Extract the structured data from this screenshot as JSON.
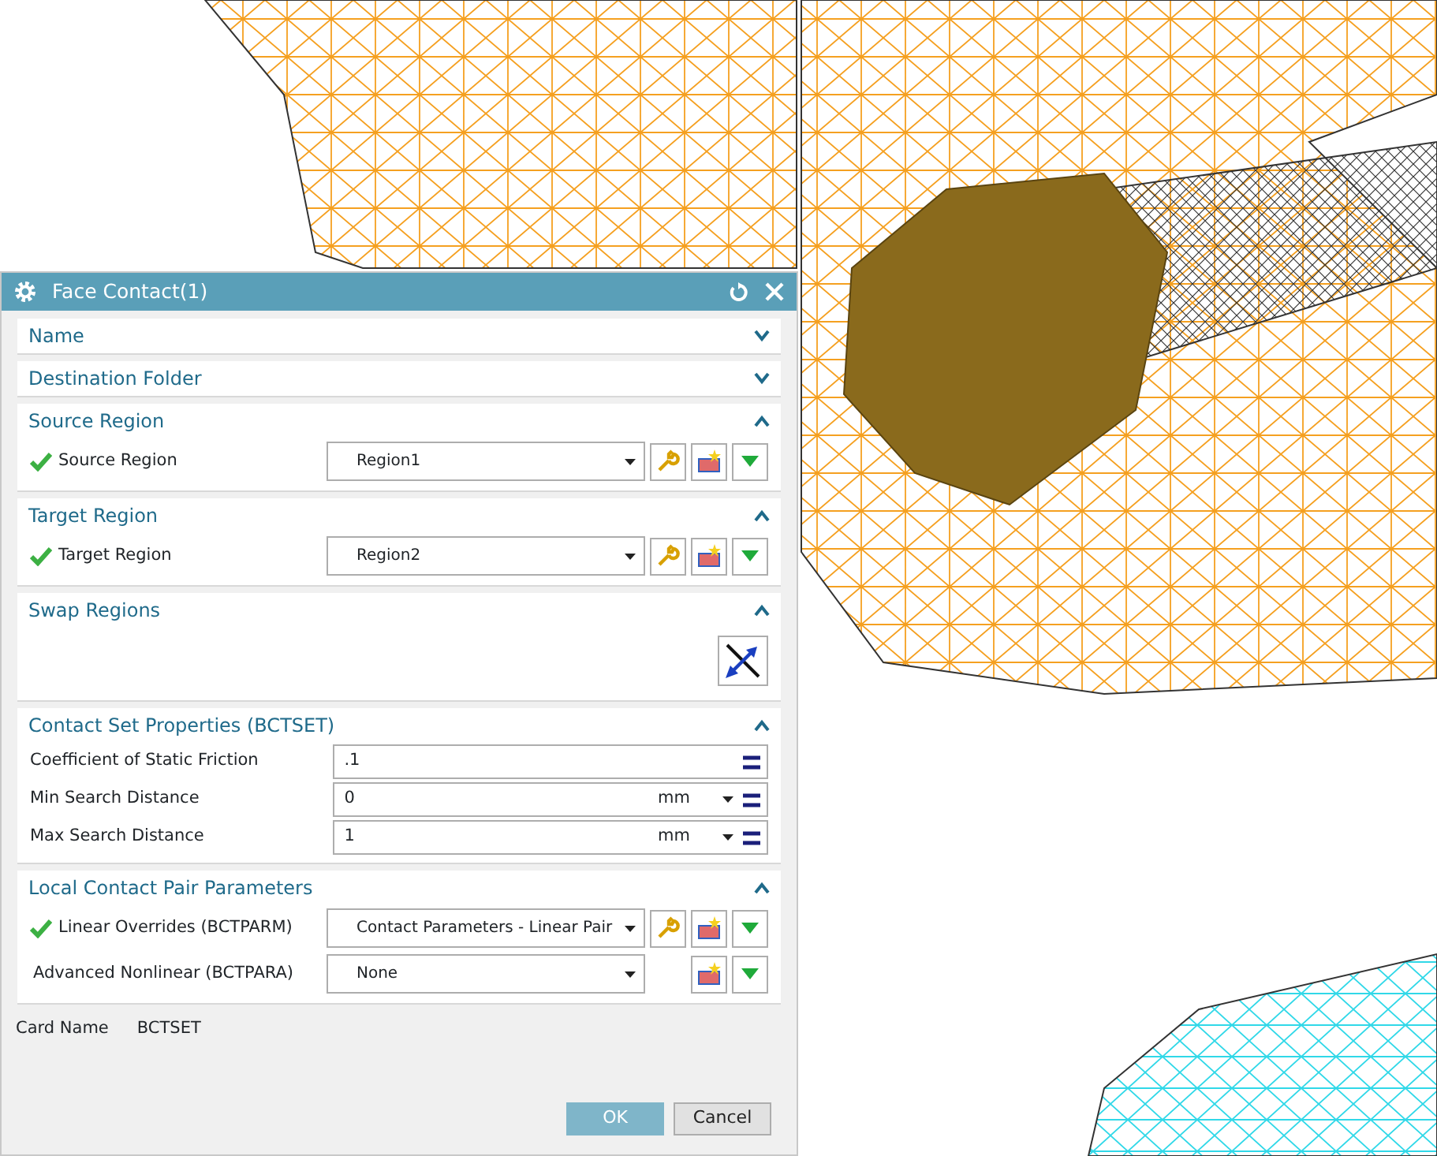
{
  "dialog": {
    "title": "Face Contact(1)",
    "sections": [
      {
        "title": "Name",
        "expanded": false
      },
      {
        "title": "Destination Folder",
        "expanded": false
      },
      {
        "title": "Source Region",
        "expanded": true,
        "rows": [
          {
            "kind": "select",
            "label": "Source Region",
            "valid": true,
            "value": "Region1",
            "edit_button": true
          }
        ]
      },
      {
        "title": "Target Region",
        "expanded": true,
        "rows": [
          {
            "kind": "select",
            "label": "Target Region",
            "valid": true,
            "value": "Region2",
            "edit_button": true
          }
        ]
      },
      {
        "title": "Swap Regions",
        "expanded": true,
        "rows": [
          {
            "kind": "swap"
          }
        ]
      },
      {
        "title": "Contact Set Properties (BCTSET)",
        "expanded": true,
        "rows": [
          {
            "kind": "number",
            "label": "Coefficient of Static Friction",
            "value": ".1"
          },
          {
            "kind": "number",
            "label": "Min Search Distance",
            "value": "0",
            "unit": "mm"
          },
          {
            "kind": "number",
            "label": "Max Search Distance",
            "value": "1",
            "unit": "mm"
          }
        ]
      },
      {
        "title": "Local Contact Pair Parameters",
        "expanded": true,
        "rows": [
          {
            "kind": "select",
            "label": "Linear Overrides (BCTPARM)",
            "valid": true,
            "value": "Contact Parameters - Linear Pair",
            "edit_button": true
          },
          {
            "kind": "select",
            "label": "Advanced Nonlinear (BCTPARA)",
            "valid": false,
            "value": "None",
            "edit_button": false
          }
        ]
      }
    ],
    "card_name": {
      "label": "Card Name",
      "value": "BCTSET"
    },
    "buttons": [
      {
        "label": "OK",
        "kind": "default"
      },
      {
        "label": "Cancel",
        "kind": "normal"
      }
    ]
  }
}
